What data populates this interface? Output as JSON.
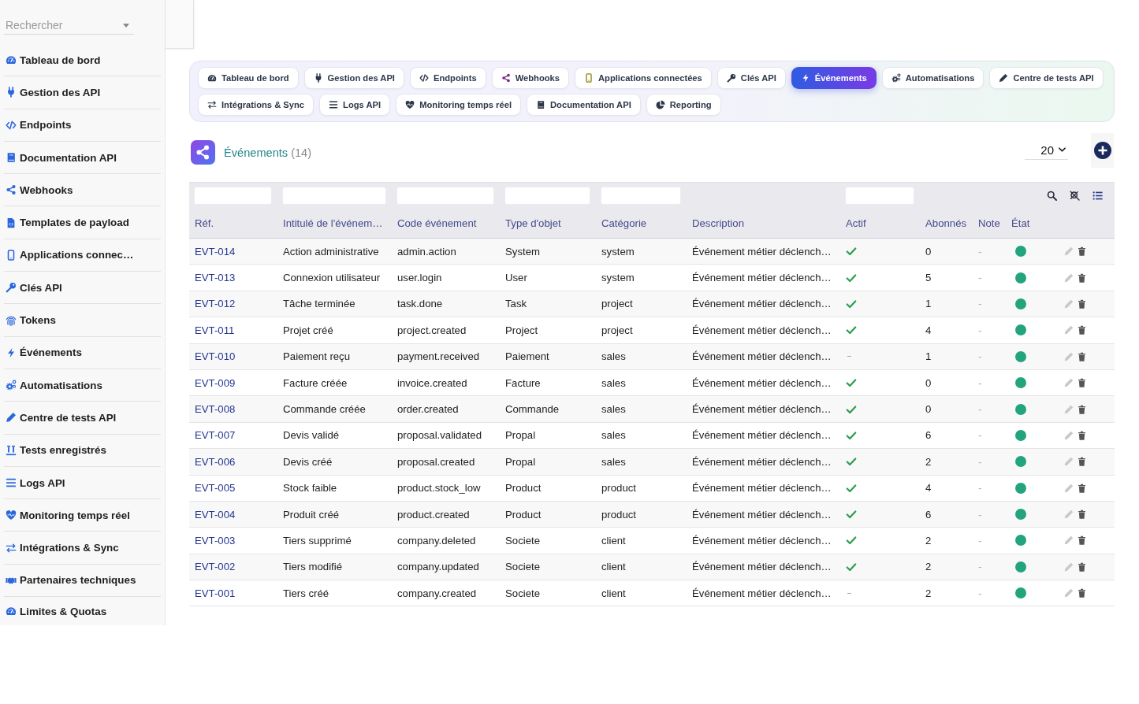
{
  "sidebar": {
    "search": {
      "placeholder": "Rechercher"
    },
    "items": [
      {
        "label": "Tableau de bord"
      },
      {
        "label": "Gestion des API"
      },
      {
        "label": "Endpoints"
      },
      {
        "label": "Documentation API"
      },
      {
        "label": "Webhooks"
      },
      {
        "label": "Templates de payload"
      },
      {
        "label": "Applications connec…"
      },
      {
        "label": "Clés API"
      },
      {
        "label": "Tokens"
      },
      {
        "label": "Événements"
      },
      {
        "label": "Automatisations"
      },
      {
        "label": "Centre de tests API"
      },
      {
        "label": "Tests enregistrés"
      },
      {
        "label": "Logs API"
      },
      {
        "label": "Monitoring temps réel"
      },
      {
        "label": "Intégrations & Sync"
      },
      {
        "label": "Partenaires techniques"
      },
      {
        "label": "Limites & Quotas"
      }
    ]
  },
  "tabs": [
    {
      "label": "Tableau de bord",
      "selected": false
    },
    {
      "label": "Gestion des API",
      "selected": false
    },
    {
      "label": "Endpoints",
      "selected": false
    },
    {
      "label": "Webhooks",
      "selected": false
    },
    {
      "label": "Applications connectées",
      "selected": false
    },
    {
      "label": "Clés API",
      "selected": false
    },
    {
      "label": "Événements",
      "selected": true
    },
    {
      "label": "Automatisations",
      "selected": false
    },
    {
      "label": "Centre de tests API",
      "selected": false
    },
    {
      "label": "Intégrations & Sync",
      "selected": false
    },
    {
      "label": "Logs API",
      "selected": false
    },
    {
      "label": "Monitoring temps réel",
      "selected": false
    },
    {
      "label": "Documentation API",
      "selected": false
    },
    {
      "label": "Reporting",
      "selected": false
    }
  ],
  "section": {
    "title": "Événements",
    "count": "(14)",
    "page_size": "20"
  },
  "table": {
    "columns": [
      {
        "label": "Réf.",
        "filter": true
      },
      {
        "label": "Intitulé de l'événem…",
        "filter": true
      },
      {
        "label": "Code événement",
        "filter": true
      },
      {
        "label": "Type d'objet",
        "filter": true
      },
      {
        "label": "Catégorie",
        "filter": true
      },
      {
        "label": "Description",
        "filter": false
      },
      {
        "label": "Actif",
        "filter": true
      },
      {
        "label": "Abonnés",
        "filter": false
      },
      {
        "label": "Note",
        "filter": false
      },
      {
        "label": "État",
        "filter": false
      }
    ],
    "rows": [
      {
        "ref": "EVT-014",
        "label": "Action administrative",
        "code": "admin.action",
        "object_type": "System",
        "category": "system",
        "description": "Événement métier déclench…",
        "active": true,
        "subscribers": "0",
        "note": "-",
        "color": "#22a47c"
      },
      {
        "ref": "EVT-013",
        "label": "Connexion utilisateur",
        "code": "user.login",
        "object_type": "User",
        "category": "system",
        "description": "Événement métier déclench…",
        "active": true,
        "subscribers": "5",
        "note": "-",
        "color": "#22a47c"
      },
      {
        "ref": "EVT-012",
        "label": "Tâche terminée",
        "code": "task.done",
        "object_type": "Task",
        "category": "project",
        "description": "Événement métier déclench…",
        "active": true,
        "subscribers": "1",
        "note": "-",
        "color": "#22a47c"
      },
      {
        "ref": "EVT-011",
        "label": "Projet créé",
        "code": "project.created",
        "object_type": "Project",
        "category": "project",
        "description": "Événement métier déclench…",
        "active": true,
        "subscribers": "4",
        "note": "-",
        "color": "#22a47c"
      },
      {
        "ref": "EVT-010",
        "label": "Paiement reçu",
        "code": "payment.received",
        "object_type": "Paiement",
        "category": "sales",
        "description": "Événement métier déclench…",
        "active": false,
        "subscribers": "1",
        "note": "-",
        "color": "#22a47c"
      },
      {
        "ref": "EVT-009",
        "label": "Facture créée",
        "code": "invoice.created",
        "object_type": "Facture",
        "category": "sales",
        "description": "Événement métier déclench…",
        "active": true,
        "subscribers": "0",
        "note": "-",
        "color": "#22a47c"
      },
      {
        "ref": "EVT-008",
        "label": "Commande créée",
        "code": "order.created",
        "object_type": "Commande",
        "category": "sales",
        "description": "Événement métier déclench…",
        "active": true,
        "subscribers": "0",
        "note": "-",
        "color": "#22a47c"
      },
      {
        "ref": "EVT-007",
        "label": "Devis validé",
        "code": "proposal.validated",
        "object_type": "Propal",
        "category": "sales",
        "description": "Événement métier déclench…",
        "active": true,
        "subscribers": "6",
        "note": "-",
        "color": "#22a47c"
      },
      {
        "ref": "EVT-006",
        "label": "Devis créé",
        "code": "proposal.created",
        "object_type": "Propal",
        "category": "sales",
        "description": "Événement métier déclench…",
        "active": true,
        "subscribers": "2",
        "note": "-",
        "color": "#22a47c"
      },
      {
        "ref": "EVT-005",
        "label": "Stock faible",
        "code": "product.stock_low",
        "object_type": "Product",
        "category": "product",
        "description": "Événement métier déclench…",
        "active": true,
        "subscribers": "4",
        "note": "-",
        "color": "#22a47c"
      },
      {
        "ref": "EVT-004",
        "label": "Produit créé",
        "code": "product.created",
        "object_type": "Product",
        "category": "product",
        "description": "Événement métier déclench…",
        "active": true,
        "subscribers": "6",
        "note": "-",
        "color": "#22a47c"
      },
      {
        "ref": "EVT-003",
        "label": "Tiers supprimé",
        "code": "company.deleted",
        "object_type": "Societe",
        "category": "client",
        "description": "Événement métier déclench…",
        "active": true,
        "subscribers": "2",
        "note": "-",
        "color": "#22a47c"
      },
      {
        "ref": "EVT-002",
        "label": "Tiers modifié",
        "code": "company.updated",
        "object_type": "Societe",
        "category": "client",
        "description": "Événement métier déclench…",
        "active": true,
        "subscribers": "2",
        "note": "-",
        "color": "#22a47c"
      },
      {
        "ref": "EVT-001",
        "label": "Tiers créé",
        "code": "company.created",
        "object_type": "Societe",
        "category": "client",
        "description": "Événement métier déclench…",
        "active": false,
        "subscribers": "2",
        "note": "-",
        "color": "#22a47c"
      }
    ]
  }
}
